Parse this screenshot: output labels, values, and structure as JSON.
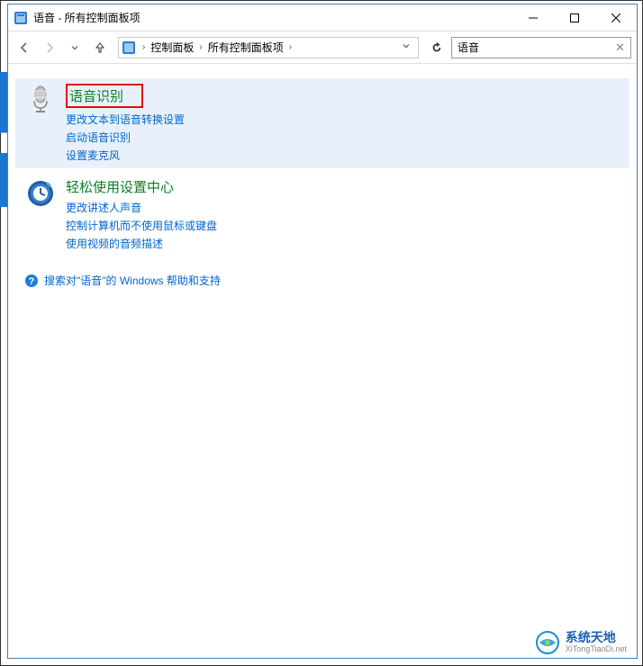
{
  "window": {
    "title": "语音 - 所有控制面板项"
  },
  "breadcrumb": {
    "items": [
      "控制面板",
      "所有控制面板项"
    ]
  },
  "search": {
    "value": "语音"
  },
  "results": [
    {
      "id": "speech-recognition",
      "title": "语音识别",
      "highlighted": true,
      "redbox": true,
      "icon": "microphone",
      "links": [
        "更改文本到语音转换设置",
        "启动语音识别",
        "设置麦克风"
      ]
    },
    {
      "id": "ease-of-access",
      "title": "轻松使用设置中心",
      "highlighted": false,
      "redbox": false,
      "icon": "ease-clock",
      "links": [
        "更改讲述人声音",
        "控制计算机而不使用鼠标或键盘",
        "使用视频的音频描述"
      ]
    }
  ],
  "help": {
    "text": "搜索对\"语音\"的 Windows 帮助和支持"
  },
  "watermark": {
    "cn": "系统天地",
    "en": "XiTongTianDi.net"
  }
}
